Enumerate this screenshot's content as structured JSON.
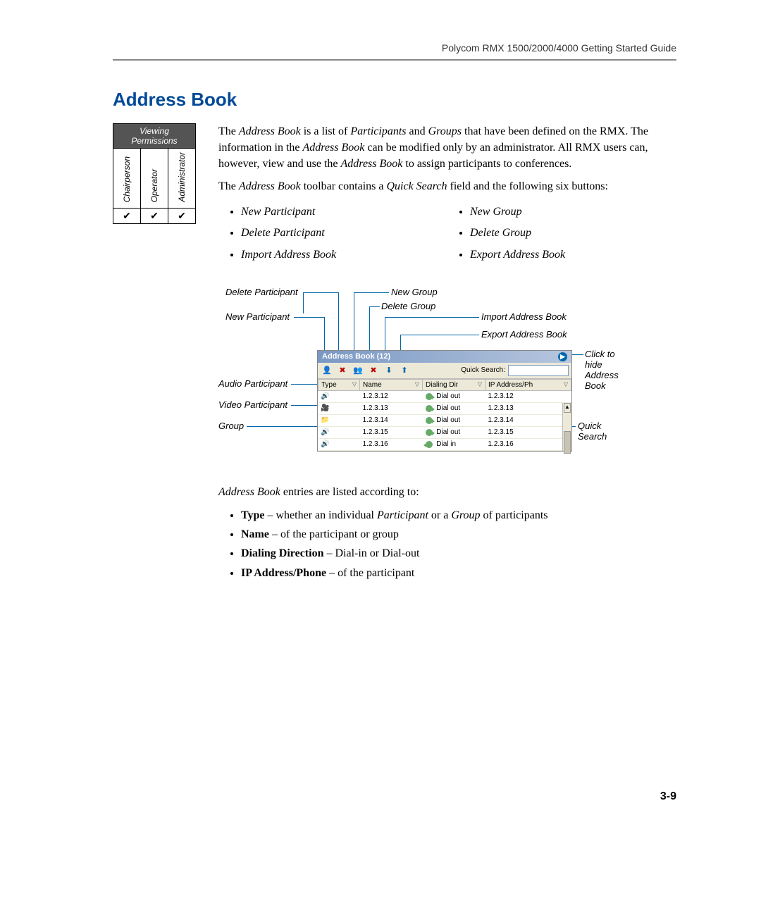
{
  "header": {
    "running": "Polycom RMX 1500/2000/4000 Getting Started Guide"
  },
  "title": "Address Book",
  "permissions": {
    "caption": "Viewing Permissions",
    "roles": [
      "Chairperson",
      "Operator",
      "Administrator"
    ],
    "check": "✔"
  },
  "para1_a": "The ",
  "para1_b": "Address Book",
  "para1_c": " is a list of ",
  "para1_d": "Participants",
  "para1_e": " and ",
  "para1_f": "Groups",
  "para1_g": " that have been defined on the RMX. The information in the ",
  "para1_h": "Address Book",
  "para1_i": " can be modified only by an administrator. All RMX users can, however, view and use the ",
  "para1_j": "Address Book",
  "para1_k": " to assign participants to conferences.",
  "para2_a": "The ",
  "para2_b": "Address Book",
  "para2_c": " toolbar contains a ",
  "para2_d": "Quick Search",
  "para2_e": " field and the following six buttons:",
  "buttons": {
    "left": [
      "New Participant",
      "Delete Participant",
      "Import Address Book"
    ],
    "right": [
      "New Group",
      "Delete Group",
      "Export Address Book"
    ]
  },
  "annot": {
    "delete_participant": "Delete Participant",
    "new_participant": "New Participant",
    "new_group": "New Group",
    "delete_group": "Delete Group",
    "import": "Import Address Book",
    "export": "Export Address Book",
    "audio": "Audio Participant",
    "video": "Video Participant",
    "group": "Group",
    "click_hide": "Click to hide Address Book",
    "quick_search": "Quick Search"
  },
  "ui": {
    "title": "Address Book (12)",
    "quick_search_label": "Quick Search:",
    "columns": [
      "Type",
      "Name",
      "Dialing Dir",
      "IP Address/Ph"
    ],
    "rows": [
      {
        "type": "audio",
        "name": "1.2.3.12",
        "dir": "Dial out",
        "ip": "1.2.3.12"
      },
      {
        "type": "video",
        "name": "1.2.3.13",
        "dir": "Dial out",
        "ip": "1.2.3.13"
      },
      {
        "type": "group",
        "name": "1.2.3.14",
        "dir": "Dial out",
        "ip": "1.2.3.14"
      },
      {
        "type": "audio",
        "name": "1.2.3.15",
        "dir": "Dial out",
        "ip": "1.2.3.15"
      },
      {
        "type": "audio",
        "name": "1.2.3.16",
        "dir": "Dial in",
        "ip": "1.2.3.16"
      }
    ]
  },
  "entries_intro_a": "Address Book",
  "entries_intro_b": " entries are listed according to:",
  "entries": [
    {
      "term": "Type",
      "rest_a": " – whether an individual ",
      "rest_i1": "Participant",
      "rest_b": " or a ",
      "rest_i2": "Group",
      "rest_c": " of participants"
    },
    {
      "term": "Name",
      "rest_a": " – of the participant or group"
    },
    {
      "term": "Dialing Direction",
      "rest_a": " – Dial-in or Dial-out"
    },
    {
      "term": "IP Address/Phone",
      "rest_a": " – of the participant"
    }
  ],
  "page_number": "3-9"
}
